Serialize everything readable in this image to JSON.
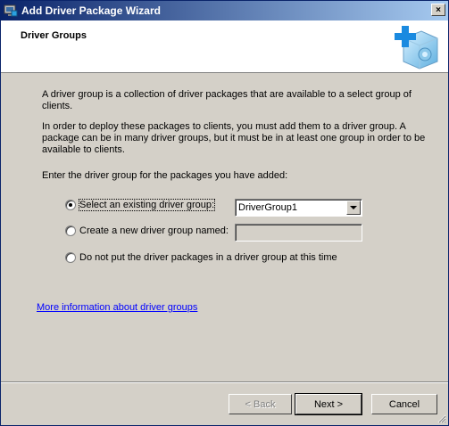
{
  "window": {
    "title": "Add Driver Package Wizard",
    "close_glyph": "×"
  },
  "header": {
    "title": "Driver Groups",
    "icon": "driver-package-add-icon"
  },
  "content": {
    "intro": "A driver group is a collection of driver packages that are available to a select group of clients.",
    "deploy_note": "In order to deploy these packages to clients, you must add them to a driver group. A package can be in many driver groups, but it must be in at least one group in order to be available to clients.",
    "prompt": "Enter the driver group for the packages you have added:",
    "options": [
      {
        "label": "Select an existing driver group:",
        "selected": true
      },
      {
        "label": "Create a new driver group named:",
        "selected": false
      },
      {
        "label": "Do not put the driver packages in a driver group at this time",
        "selected": false
      }
    ],
    "existing_group_value": "DriverGroup1",
    "new_group_value": "",
    "more_info_link": "More information about driver groups"
  },
  "buttons": {
    "back": "< Back",
    "next": "Next >",
    "cancel": "Cancel"
  },
  "colors": {
    "titlebar_start": "#0a246a",
    "titlebar_end": "#a6caf0",
    "face": "#d4d0c8",
    "link": "#0000ff"
  }
}
